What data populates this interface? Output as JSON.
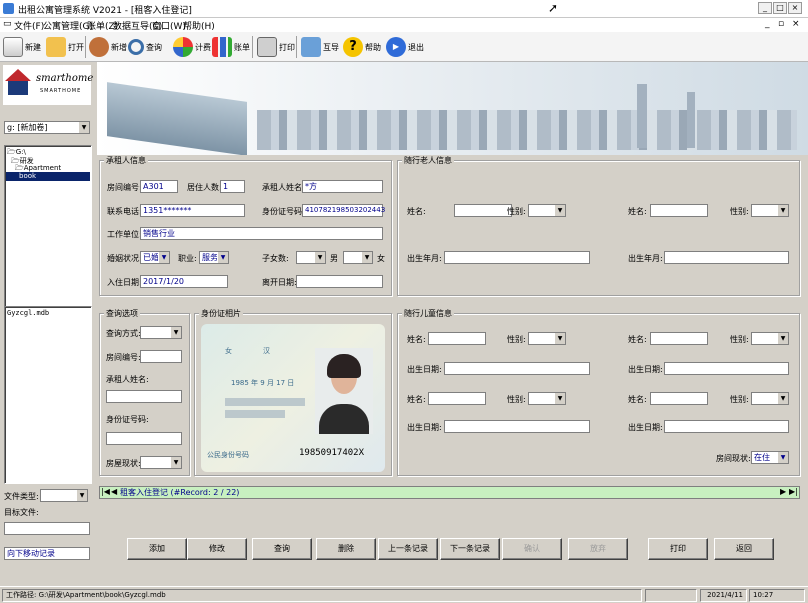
{
  "window": {
    "title": "出租公寓管理系统 V2021 - [租客入住登记]"
  },
  "menu": [
    "文件(F)",
    "公寓管理(G)",
    "账单(Z)",
    "数据互导(C)",
    "窗口(W)",
    "帮助(H)"
  ],
  "toolbar": [
    "新建",
    "打开",
    "新增",
    "查询",
    "计费",
    "账单",
    "打印",
    "互导",
    "帮助",
    "退出"
  ],
  "logo": {
    "brand": "smarthome",
    "sub": "SMARTHOME"
  },
  "drive": {
    "value": "g: [新加卷]"
  },
  "tree": [
    "G:\\",
    "研发",
    "Apartment",
    "book"
  ],
  "filelist": [
    "Gyzcgl.mdb"
  ],
  "left": {
    "filetype_label": "文件类型:",
    "target_label": "目标文件:",
    "move_label": "向下移动记录"
  },
  "tenant": {
    "group_title": "承租人信息",
    "room_no_label": "房间编号:",
    "room_no": "A301",
    "residents_label": "居住人数:",
    "residents": "1",
    "name_label": "承租人姓名:",
    "name": "*方",
    "phone_label": "联系电话:",
    "phone": "1351*******",
    "idcard_label": "身份证号码:",
    "idcard": "41078219850320244З",
    "work_label": "工作单位:",
    "work": "销售行业",
    "marital_label": "婚姻状况:",
    "marital": "已婚",
    "job_label": "职业:",
    "job": "服务",
    "children_label": "子女数:",
    "male_label": "男",
    "female_label": "女",
    "checkin_label": "入住日期:",
    "checkin": "2017/1/20",
    "checkout_label": "离开日期:"
  },
  "adults": {
    "group_title": "随行老人信息",
    "name_label": "姓名:",
    "sex_label": "性别:",
    "birth_label": "出生年月:"
  },
  "query": {
    "group_title": "查询选项",
    "method_label": "查询方式:",
    "room_label": "房间编号:",
    "name_label": "承租人姓名:",
    "id_label": "身份证号码:",
    "status_label": "房屋现状:"
  },
  "photo": {
    "group_title": "身份证相片",
    "id_number": "19850917402X",
    "dob": "1985 年 9 月 17 日",
    "sex": "女",
    "ethnic": "汉",
    "id_label": "公民身份号码"
  },
  "kids": {
    "group_title": "随行儿童信息",
    "name_label": "姓名:",
    "sex_label": "性别:",
    "birth_label": "出生日期:",
    "status_label": "房间现状:",
    "status_value": "在住"
  },
  "nav": {
    "record_text": "租客入住登记 (#Record: 2 / 22)"
  },
  "buttons": [
    "添加",
    "修改",
    "查询",
    "删除",
    "上一条记录",
    "下一条记录",
    "确认",
    "放弃",
    "打印",
    "返回"
  ],
  "status": {
    "path": "工作路径: G:\\研发\\Apartment\\book\\Gyzcgl.mdb",
    "date": "2021/4/11",
    "time": "10:27"
  },
  "colors": {
    "accent": "#00008b",
    "nav_bar": "#c8f0c0",
    "tree_selected": "#0a246a"
  }
}
